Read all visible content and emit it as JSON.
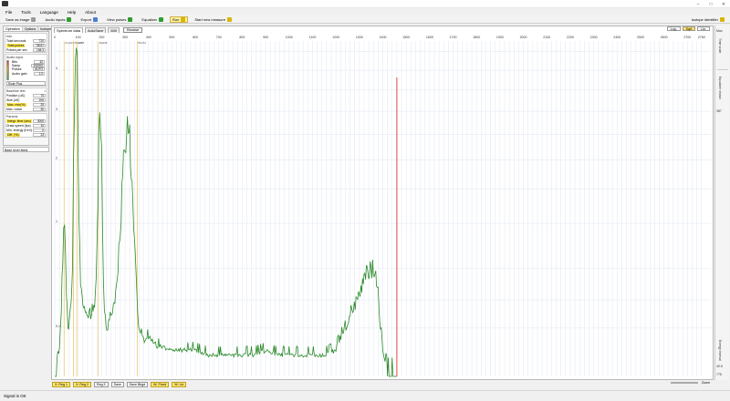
{
  "toolbar": {
    "save_as_image": "Save as image",
    "audio_inputs": "Audio inputs",
    "export": "Export",
    "view_pulses": "View pulses",
    "equalizer": "Equalizer",
    "run": "Run",
    "start_new_measure": "Start new measure",
    "isotope_identifier": "Isotope identifier"
  },
  "menu": [
    "File",
    "Tools",
    "Language",
    "Help",
    "About"
  ],
  "left_tabs": [
    "Operation",
    "Options",
    "Isotopes"
  ],
  "info": {
    "header": "Info",
    "rows": [
      {
        "label": "Total seconds",
        "value": "720"
      },
      {
        "label": "Total pulses",
        "value": "78037"
      },
      {
        "label": "Pulses per sec",
        "value": "108.3"
      }
    ]
  },
  "audio_input": {
    "header": "Audio input",
    "rows": [
      {
        "label": "Bits",
        "value": "32"
      },
      {
        "label": "Samp",
        "value": "192000"
      },
      {
        "label": "Pulses",
        "value": "AUTO"
      },
      {
        "label": "Audio gain",
        "value": "1.0"
      }
    ],
    "device": "Rode Plus"
  },
  "baseline": {
    "header": "Baseline test",
    "rows": [
      {
        "label": "Position (uS)",
        "value": "70"
      },
      {
        "label": "Size (uS)",
        "value": "200"
      },
      {
        "label": "Max. min(%)",
        "value": "25"
      },
      {
        "label": "Max. noise",
        "value": "30"
      }
    ]
  },
  "params": {
    "header": "Params",
    "rows": [
      {
        "label": "Integr. time (sec)",
        "value": "3000"
      },
      {
        "label": "Draw speed (fps)",
        "value": "10"
      },
      {
        "label": "Min. energy (KeV)",
        "value": "0"
      },
      {
        "label": "Diff. (%)",
        "value": "23"
      }
    ]
  },
  "small_box": "Base level fixed.",
  "chart_tabs": [
    "Spectrum data",
    "AutoSave",
    "600"
  ],
  "browse_label": "Browse",
  "scale_buttons": [
    "Log.",
    "Sqrt",
    "Lin."
  ],
  "right_strip": {
    "labels": [
      "Time scale",
      "Equalizer shown",
      "Energy Interval"
    ],
    "values": [
      "Max",
      "387",
      "40.5",
      "775"
    ]
  },
  "bottom_buttons": [
    "X: Reg 1",
    "X: Reg 2",
    "Reg 3",
    "Save",
    "Save Bkgd",
    "W: Fixed",
    "W: Lin"
  ],
  "zoom_label": "Zoom",
  "status": "Signal is OK",
  "chart_data": {
    "type": "line",
    "x_ticks": [
      0,
      20,
      40,
      60,
      80,
      100,
      120,
      140,
      160,
      180,
      200,
      220,
      240,
      260,
      280,
      300,
      320,
      340,
      360,
      380,
      400,
      420,
      440,
      460,
      480,
      500,
      520,
      540,
      560,
      580,
      600,
      620,
      640,
      660,
      680,
      700,
      720,
      740,
      760,
      780,
      800,
      820,
      840,
      860,
      880,
      900,
      920,
      940,
      960,
      980,
      1000,
      1020,
      1040,
      1060,
      1080,
      1100,
      1120,
      1140,
      1160,
      1180,
      1200,
      1220,
      1240,
      1260,
      1280,
      1300,
      1320,
      1340,
      1360,
      1380,
      1400,
      1420,
      1440,
      1460,
      1480,
      1500,
      1520,
      1540,
      1560,
      1580,
      1600,
      1620,
      1640,
      1660,
      1680,
      1700,
      1720,
      1740,
      1760,
      1780,
      1800,
      1820,
      1840,
      1860,
      1880,
      1900,
      1920,
      1940,
      1960,
      1980,
      2000,
      2020,
      2040,
      2060,
      2080,
      2100,
      2120,
      2140,
      2160,
      2180,
      2200,
      2220,
      2240,
      2260,
      2280,
      2300,
      2320,
      2340,
      2360,
      2380,
      2400,
      2420,
      2440,
      2460,
      2480,
      2500,
      2520,
      2540,
      2560,
      2580,
      2600,
      2620,
      2640,
      2660,
      2680,
      2700,
      2720,
      2740,
      2760
    ],
    "x_ticks_shown_every": 100,
    "y_ticks": [
      "0.1",
      "1",
      "2",
      "3",
      "4"
    ],
    "xlim": [
      0,
      2800
    ],
    "y_scale": "sqrt",
    "peak_markers": [
      {
        "x": 40,
        "label": "Am241"
      },
      {
        "x": 80,
        "label": "Ba133"
      },
      {
        "x": 94,
        "label": "U235"
      },
      {
        "x": 186,
        "label": "Ra226"
      },
      {
        "x": 352,
        "label": "Pb214"
      }
    ],
    "red_marker_x": 1460,
    "series": {
      "x": [
        0,
        10,
        20,
        28,
        34,
        38,
        42,
        46,
        50,
        56,
        62,
        70,
        76,
        80,
        84,
        88,
        92,
        96,
        100,
        104,
        110,
        120,
        130,
        140,
        150,
        160,
        170,
        180,
        184,
        188,
        192,
        196,
        200,
        204,
        208,
        212,
        216,
        222,
        230,
        240,
        250,
        260,
        270,
        280,
        290,
        300,
        310,
        320,
        330,
        340,
        346,
        350,
        354,
        358,
        362,
        366,
        370,
        376,
        382,
        390,
        400,
        420,
        440,
        460,
        480,
        500,
        550,
        600,
        650,
        700,
        750,
        800,
        850,
        900,
        950,
        1000,
        1050,
        1100,
        1150,
        1200,
        1250,
        1300,
        1330,
        1350,
        1370,
        1380,
        1390,
        1400,
        1410,
        1420,
        1430,
        1440,
        1450,
        1460
      ],
      "y": [
        0,
        0,
        0.03,
        0.2,
        0.6,
        0.95,
        1.0,
        0.7,
        0.3,
        0.1,
        0.12,
        0.25,
        0.6,
        1.8,
        3.5,
        4.4,
        4.55,
        3.8,
        2.2,
        1.0,
        0.4,
        0.24,
        0.18,
        0.16,
        0.16,
        0.18,
        0.25,
        0.6,
        1.5,
        2.6,
        2.9,
        2.7,
        2.2,
        0.8,
        0.3,
        0.16,
        0.12,
        0.1,
        0.12,
        0.15,
        0.2,
        0.3,
        0.48,
        0.9,
        1.6,
        2.5,
        2.95,
        2.4,
        1.4,
        0.7,
        0.5,
        0.3,
        0.18,
        0.12,
        0.09,
        0.08,
        0.07,
        0.07,
        0.06,
        0.06,
        0.07,
        0.05,
        0.04,
        0.04,
        0.03,
        0.03,
        0.03,
        0.03,
        0.02,
        0.02,
        0.02,
        0.02,
        0.02,
        0.03,
        0.02,
        0.02,
        0.02,
        0.02,
        0.02,
        0.03,
        0.12,
        0.3,
        0.45,
        0.52,
        0.4,
        0.28,
        0.1,
        0.03,
        0.01,
        0,
        0,
        0,
        0,
        0
      ]
    }
  }
}
